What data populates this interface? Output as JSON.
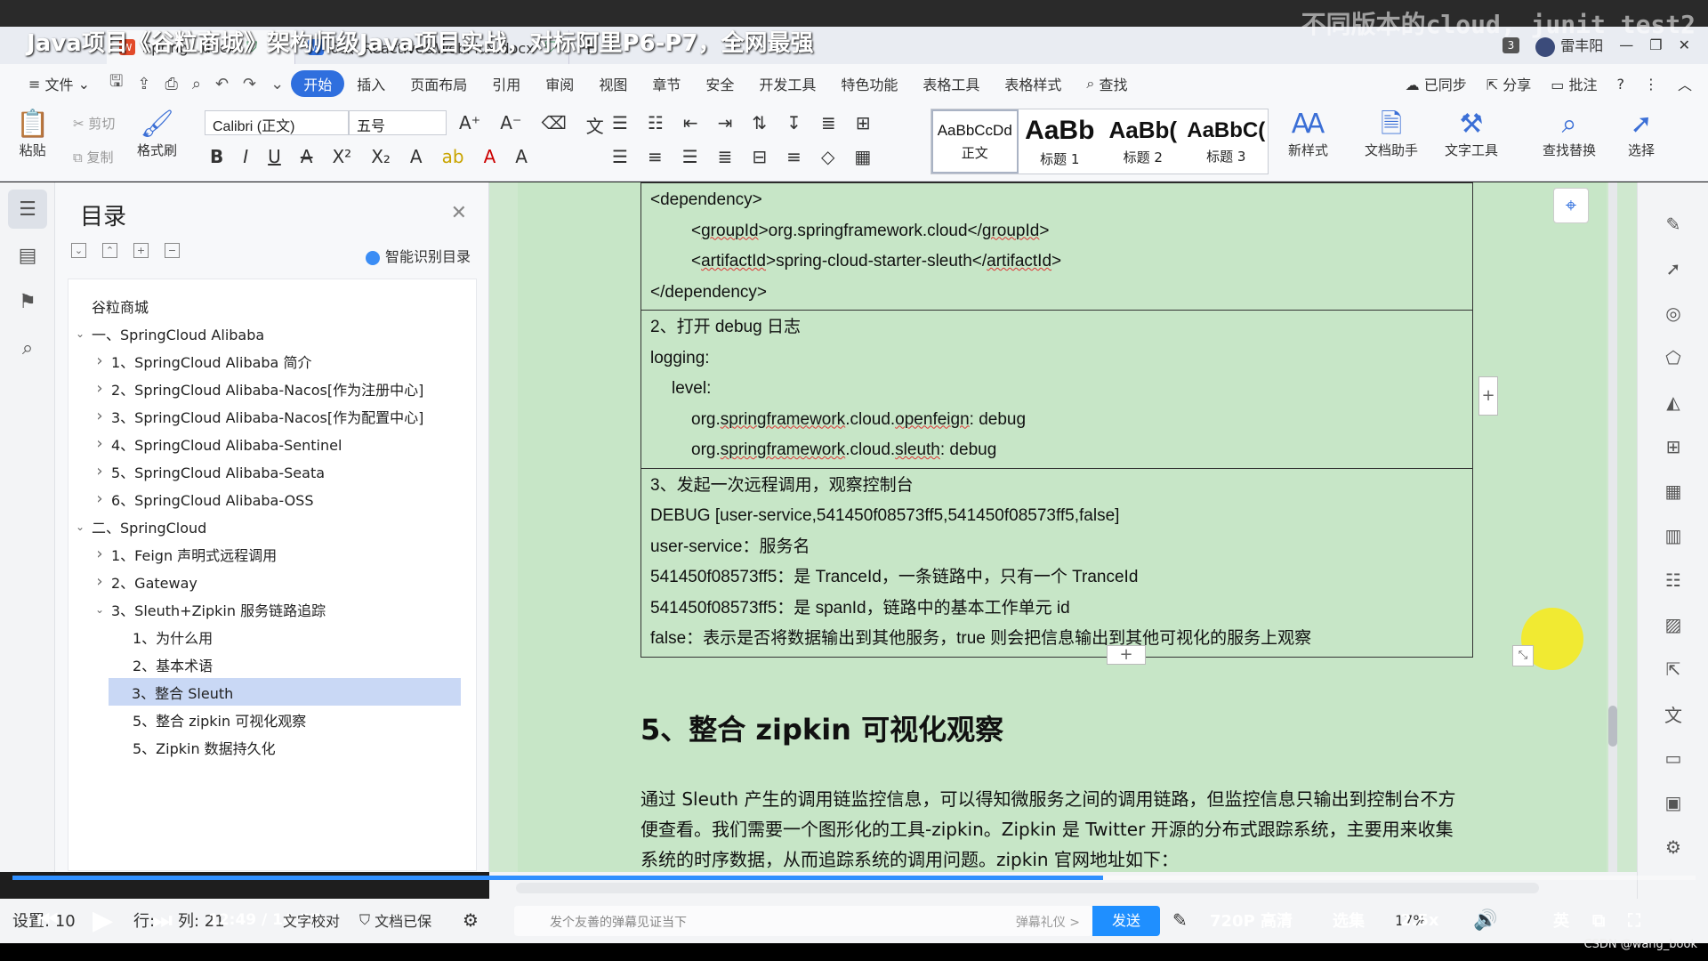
{
  "video": {
    "title": "Java项目《谷粒商城》架构师级Java项目实战，对标阿里P6-P7，全网最强",
    "overlay_right": "不同版本的cloud, junit test2"
  },
  "tabs": [
    {
      "label": "Spring...docx",
      "active": true
    },
    {
      "label": "01、Reactive&WebFlux.docx",
      "active": false
    }
  ],
  "tabbar_right": {
    "count": "3",
    "user": "雷丰阳"
  },
  "menu": {
    "file": "文件",
    "items": [
      "开始",
      "插入",
      "页面布局",
      "引用",
      "审阅",
      "视图",
      "章节",
      "安全",
      "开发工具",
      "特色功能",
      "表格工具",
      "表格样式"
    ],
    "active": "开始",
    "search": "查找",
    "right": [
      "已同步",
      "分享",
      "批注"
    ]
  },
  "ribbon": {
    "paste": "粘贴",
    "cut": "剪切",
    "copy": "复制",
    "format_painter": "格式刷",
    "font": "Calibri (正文)",
    "size": "五号",
    "styles": [
      {
        "sample": "AaBbCcDd",
        "label": "正文"
      },
      {
        "sample": "AaBb",
        "label": "标题 1"
      },
      {
        "sample": "AaBb(",
        "label": "标题 2"
      },
      {
        "sample": "AaBbC(",
        "label": "标题 3"
      }
    ],
    "new_style": "新样式",
    "doc_assistant": "文档助手",
    "text_tools": "文字工具",
    "find_replace": "查找替换",
    "select": "选择"
  },
  "toc": {
    "title": "目录",
    "smart": "智能识别目录",
    "items": [
      {
        "text": "谷粒商城",
        "level": 0,
        "chev": ""
      },
      {
        "text": "一、SpringCloud Alibaba",
        "level": 0,
        "chev": "v"
      },
      {
        "text": "1、SpringCloud Alibaba 简介",
        "level": 1,
        "chev": ">"
      },
      {
        "text": "2、SpringCloud Alibaba-Nacos[作为注册中心]",
        "level": 1,
        "chev": ">"
      },
      {
        "text": "3、SpringCloud Alibaba-Nacos[作为配置中心]",
        "level": 1,
        "chev": ">"
      },
      {
        "text": "4、SpringCloud Alibaba-Sentinel",
        "level": 1,
        "chev": ">"
      },
      {
        "text": "5、SpringCloud Alibaba-Seata",
        "level": 1,
        "chev": ">"
      },
      {
        "text": "6、SpringCloud Alibaba-OSS",
        "level": 1,
        "chev": ">"
      },
      {
        "text": "二、SpringCloud",
        "level": 0,
        "chev": "v"
      },
      {
        "text": "1、Feign 声明式远程调用",
        "level": 1,
        "chev": ">"
      },
      {
        "text": "2、Gateway",
        "level": 1,
        "chev": ">"
      },
      {
        "text": "3、Sleuth+Zipkin 服务链路追踪",
        "level": 1,
        "chev": "v"
      },
      {
        "text": "1、为什么用",
        "level": 2,
        "chev": ""
      },
      {
        "text": "2、基本术语",
        "level": 2,
        "chev": ""
      },
      {
        "text": "3、整合 Sleuth",
        "level": 2,
        "chev": "",
        "selected": true
      },
      {
        "text": "5、整合 zipkin 可视化观察",
        "level": 2,
        "chev": ""
      },
      {
        "text": "5、Zipkin 数据持久化",
        "level": 2,
        "chev": ""
      }
    ]
  },
  "doc": {
    "cell1": [
      "<dependency>",
      "<groupId>org.springframework.cloud</groupId>",
      "<artifactId>spring-cloud-starter-sleuth</artifactId>",
      "</dependency>"
    ],
    "cell2": [
      "2、打开 debug 日志",
      "logging:",
      "level:",
      "org.springframework.cloud.openfeign: debug",
      "org.springframework.cloud.sleuth: debug"
    ],
    "cell3": [
      "3、发起一次远程调用，观察控制台",
      "DEBUG [user-service,541450f08573ff5,541450f08573ff5,false]",
      "user-service：服务名",
      "541450f08573ff5：是 TranceId，一条链路中，只有一个 TranceId",
      "541450f08573ff5：是 spanId，链路中的基本工作单元 id",
      "false：表示是否将数据输出到其他服务，true 则会把信息输出到其他可视化的服务上观察"
    ],
    "heading": "5、整合 zipkin 可视化观察",
    "para": "通过 Sleuth 产生的调用链监控信息，可以得知微服务之间的调用链路，但监控信息只输出到控制台不方便查看。我们需要一个图形化的工具-zipkin。Zipkin 是 Twitter 开源的分布式跟踪系统，主要用来收集系统的时序数据，从而追踪系统的调用问题。zipkin 官网地址如下："
  },
  "player": {
    "status_left": "设置: 10",
    "row": "行:",
    "col": "列: 21",
    "time": "12:49 / 14:57",
    "text_check": "文字校对",
    "doc_saved": "文档已保",
    "danmaku_placeholder": "发个友善的弹幕见证当下",
    "etiquette": "弹幕礼仪 >",
    "send": "发送",
    "quality": "720P 高清",
    "select_episodes": "选集",
    "zoom": "17%",
    "speed": "2.5x",
    "lang": "英",
    "csdn": "CSDN @wang_book"
  }
}
